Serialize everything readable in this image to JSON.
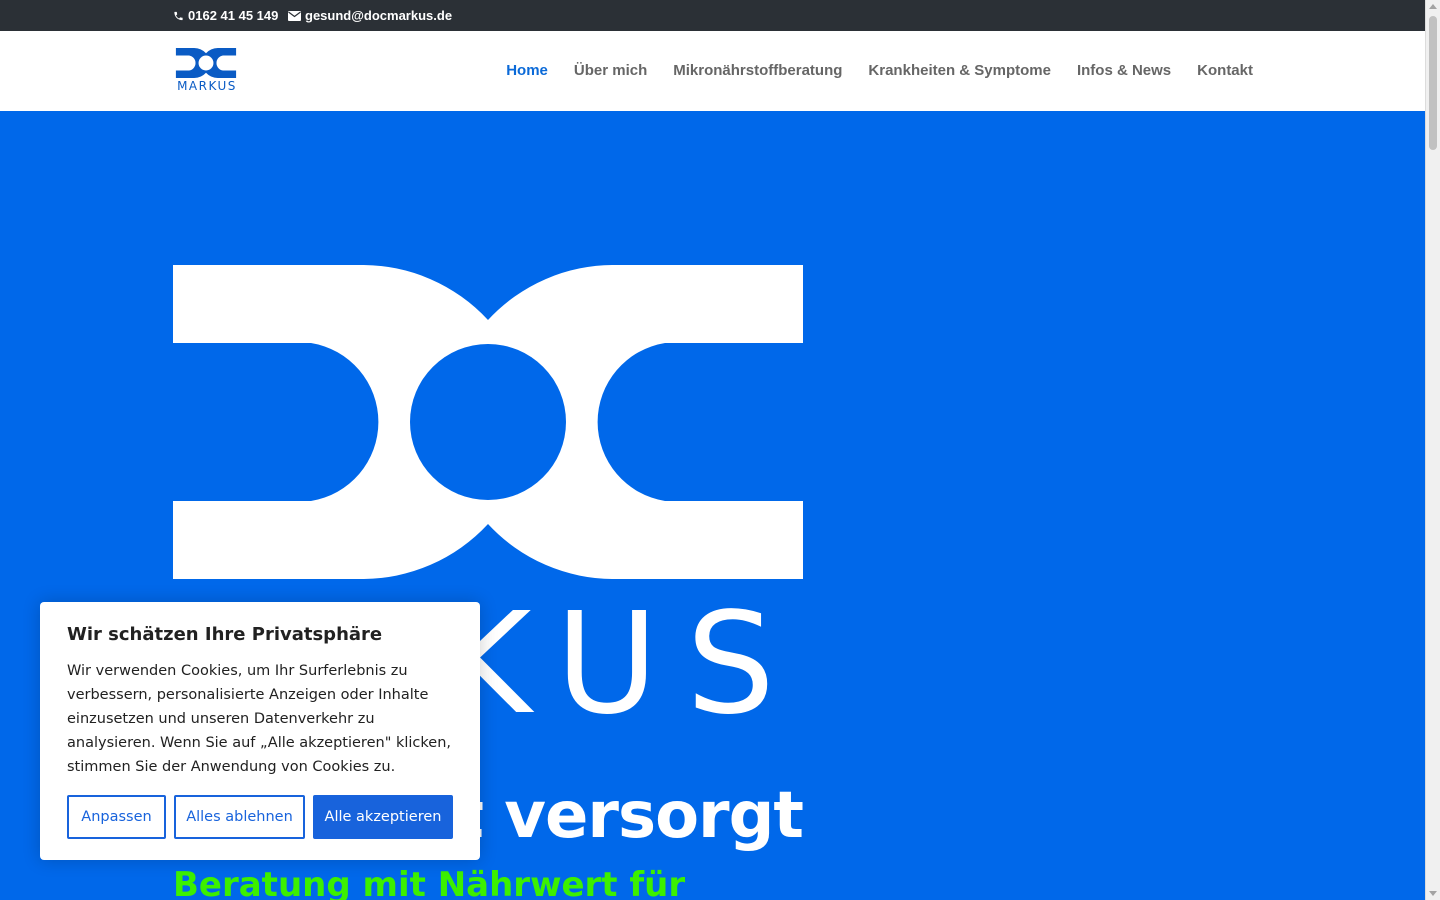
{
  "topbar": {
    "phone": "0162 41 45 149",
    "email": "gesund@docmarkus.de",
    "icons": [
      "phone-icon",
      "mail-icon"
    ]
  },
  "header": {
    "logo_text": "MARKUS",
    "nav": [
      {
        "label": "Home",
        "active": true
      },
      {
        "label": "Über mich",
        "active": false
      },
      {
        "label": "Mikronährstoffberatung",
        "active": false
      },
      {
        "label": "Krankheiten & Symptome",
        "active": false
      },
      {
        "label": "Infos & News",
        "active": false
      },
      {
        "label": "Kontakt",
        "active": false
      }
    ]
  },
  "hero": {
    "logo_word": "MARKUS",
    "headline": "ut versorgt",
    "subheadline": "Beratung mit Nährwert für"
  },
  "cookie_banner": {
    "title": "Wir schätzen Ihre Privatsphäre",
    "text": "Wir verwenden Cookies, um Ihr Surferlebnis zu verbessern, personalisierte Anzeigen oder Inhalte einzusetzen und unseren Datenverkehr zu analysieren. Wenn Sie auf „Alle akzeptieren\" klicken, stimmen Sie der Anwendung von Cookies zu.",
    "buttons": {
      "customize": "Anpassen",
      "reject": "Alles ablehnen",
      "accept": "Alle akzeptieren"
    }
  },
  "colors": {
    "brand_blue": "#0068ea",
    "topbar_bg": "#2b3036",
    "nav_active": "#0b6ad8",
    "accent_green": "#3cf000",
    "button_blue": "#1863dc"
  }
}
